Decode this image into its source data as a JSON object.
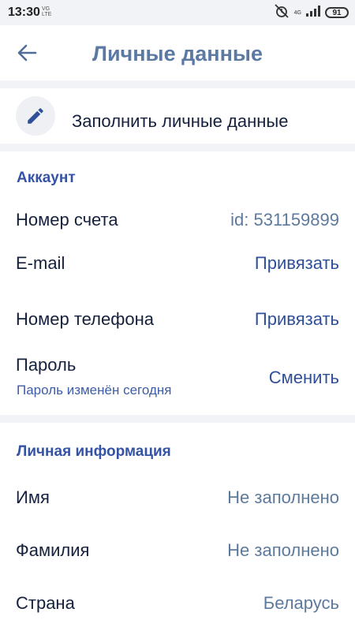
{
  "status_bar": {
    "time": "13:30",
    "carrier_small_top": "VG",
    "carrier_small_bottom": "LTE",
    "network_label": "4G",
    "battery": "91",
    "icons": [
      "alarm-off-icon",
      "signal-icon",
      "battery-icon"
    ]
  },
  "header": {
    "title": "Личные данные",
    "back_icon": "arrow-left-icon"
  },
  "fill_action": {
    "icon": "pencil-icon",
    "label": "Заполнить личные данные"
  },
  "account": {
    "heading": "Аккаунт",
    "rows": [
      {
        "label": "Номер счета",
        "value": "id: 531159899"
      },
      {
        "label": "E-mail",
        "action": "Привязать"
      },
      {
        "label": "Номер телефона",
        "action": "Привязать"
      },
      {
        "label": "Пароль",
        "sub": "Пароль изменён сегодня",
        "action": "Сменить"
      }
    ]
  },
  "personal": {
    "heading": "Личная информация",
    "rows": [
      {
        "label": "Имя",
        "value": "Не заполнено"
      },
      {
        "label": "Фамилия",
        "value": "Не заполнено"
      },
      {
        "label": "Страна",
        "value": "Беларусь"
      }
    ]
  },
  "colors": {
    "title": "#5b79a3",
    "accent": "#2f4f99",
    "section_heading": "#3553a5",
    "muted_value": "#5d7a9d",
    "divider": "#f1f3f7"
  }
}
